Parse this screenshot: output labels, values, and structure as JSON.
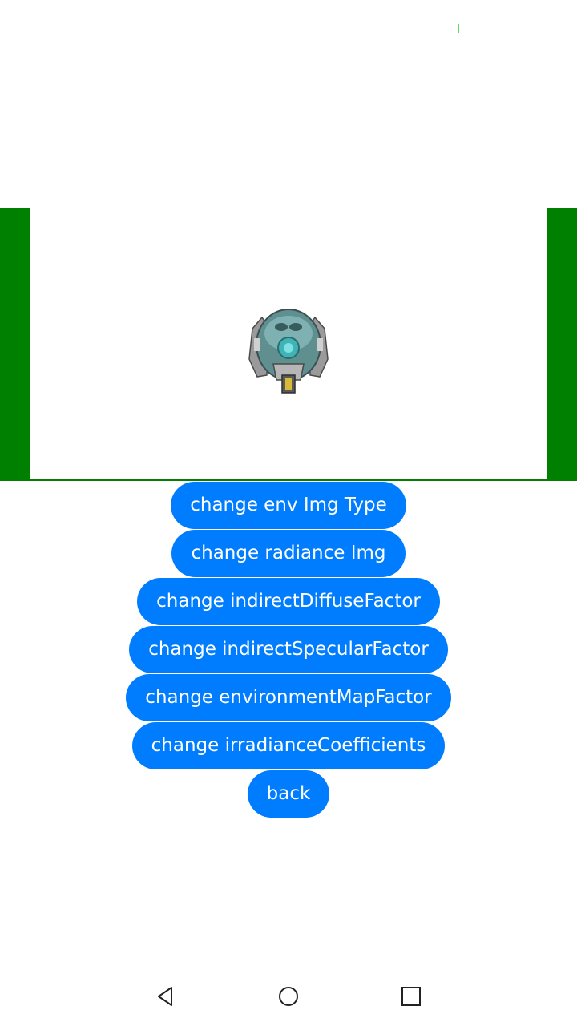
{
  "buttons": [
    {
      "label": "change env Img Type"
    },
    {
      "label": "change radiance Img"
    },
    {
      "label": "change indirectDiffuseFactor"
    },
    {
      "label": "change indirectSpecularFactor"
    },
    {
      "label": "change environmentMapFactor"
    },
    {
      "label": "change irradianceCoefficients"
    },
    {
      "label": "back"
    }
  ],
  "colors": {
    "accent": "#007dff",
    "viewport_border": "#008000",
    "background": "#ffffff"
  },
  "nav": {
    "icons": [
      "back-triangle-icon",
      "home-circle-icon",
      "recents-square-icon"
    ]
  }
}
